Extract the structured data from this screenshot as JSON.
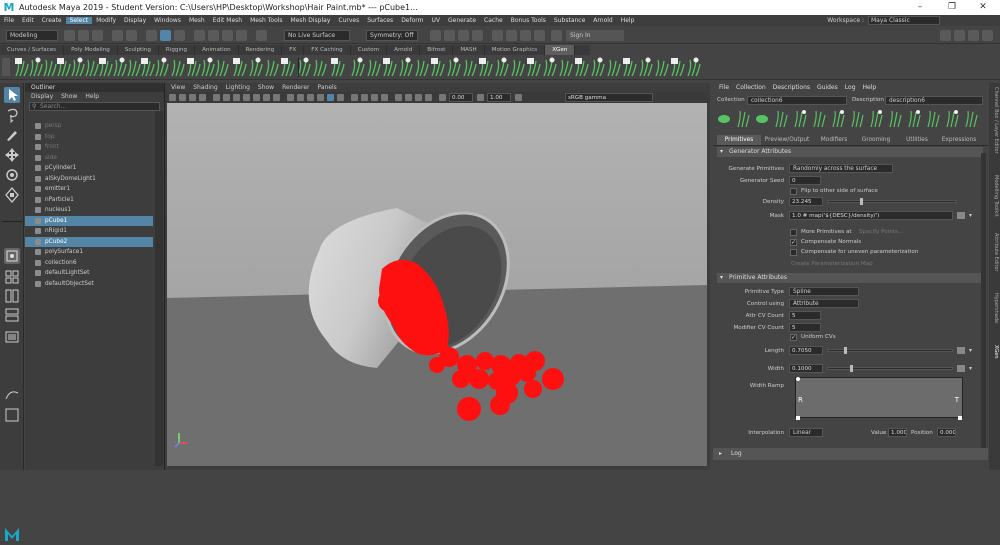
{
  "window": {
    "title": "Autodesk Maya 2019 - Student Version: C:\\Users\\HP\\Desktop\\Workshop\\Hair Paint.mb*  ---  pCube1...",
    "logo": "M",
    "controls": [
      "–",
      "❐",
      "✕"
    ]
  },
  "menubar": {
    "items": [
      "File",
      "Edit",
      "Create",
      "Select",
      "Modify",
      "Display",
      "Windows",
      "Mesh",
      "Edit Mesh",
      "Mesh Tools",
      "Mesh Display",
      "Curves",
      "Surfaces",
      "Deform",
      "UV",
      "Generate",
      "Cache",
      "Bonus Tools",
      "Substance",
      "Arnold",
      "Help"
    ],
    "selected": "Select",
    "workspace_label": "Workspace :",
    "workspace_value": "Maya Classic"
  },
  "statusline": {
    "mode": "Modeling",
    "live_surface": "No Live Surface",
    "symmetry": "Symmetry: Off",
    "sign_in": "Sign In"
  },
  "shelf": {
    "tabs": [
      "Curves / Surfaces",
      "Poly Modeling",
      "Sculpting",
      "Rigging",
      "Animation",
      "Rendering",
      "FX",
      "FX Caching",
      "Custom",
      "Arnold",
      "Bifrost",
      "MASH",
      "Motion Graphics",
      "XGen"
    ],
    "active": "XGen"
  },
  "outliner": {
    "title": "Outliner",
    "menu": [
      "Display",
      "Show",
      "Help"
    ],
    "search_placeholder": "Search...",
    "items": [
      {
        "label": "persp",
        "dim": true,
        "selected": false
      },
      {
        "label": "top",
        "dim": true,
        "selected": false
      },
      {
        "label": "front",
        "dim": true,
        "selected": false
      },
      {
        "label": "side",
        "dim": true,
        "selected": false
      },
      {
        "label": "pCylinder1",
        "dim": false,
        "selected": false
      },
      {
        "label": "aiSkyDomeLight1",
        "dim": false,
        "selected": false
      },
      {
        "label": "emitter1",
        "dim": false,
        "selected": false
      },
      {
        "label": "nParticle1",
        "dim": false,
        "selected": false
      },
      {
        "label": "nucleus1",
        "dim": false,
        "selected": false
      },
      {
        "label": "pCube1",
        "dim": false,
        "selected": true
      },
      {
        "label": "nRigid1",
        "dim": false,
        "selected": false
      },
      {
        "label": "pCube2",
        "dim": false,
        "selected": true
      },
      {
        "label": "polySurface1",
        "dim": false,
        "selected": false
      },
      {
        "label": "collection6",
        "dim": false,
        "selected": false
      },
      {
        "label": "defaultLightSet",
        "dim": false,
        "selected": false
      },
      {
        "label": "defaultObjectSet",
        "dim": false,
        "selected": false
      }
    ]
  },
  "viewport": {
    "menu": [
      "View",
      "Shading",
      "Lighting",
      "Show",
      "Renderer",
      "Panels"
    ],
    "exposure": "0.00",
    "gamma": "1.00",
    "color_space": "sRGB gamma"
  },
  "xgen": {
    "menu": [
      "File",
      "Collection",
      "Descriptions",
      "Guides",
      "Log",
      "Help"
    ],
    "collection_label": "Collection",
    "collection_value": "collection6",
    "description_label": "Description",
    "description_value": "description6",
    "tabs": [
      "Primitives",
      "Preview/Output",
      "Modifiers",
      "Grooming",
      "Utilities",
      "Expressions"
    ],
    "active_tab": "Primitives",
    "generator": {
      "title": "Generator Attributes",
      "generate_primitives_label": "Generate Primitives",
      "generate_primitives_value": "Randomly across the surface",
      "generator_seed_label": "Generator Seed",
      "generator_seed_value": "0",
      "flip_label": "Flip to other side of surface",
      "density_label": "Density",
      "density_value": "23.245",
      "mask_label": "Mask",
      "mask_value": "1.0 # map('${DESC}/density/')",
      "more_primitives_label": "More Primitives at",
      "specify_points": "Specify Points...",
      "compensate_normals": "Compensate Normals",
      "compensate_uneven": "Compensate for uneven parameterization",
      "create_param_map": "Create Parameterization Map"
    },
    "primitive": {
      "title": "Primitive Attributes",
      "primitive_type_label": "Primitive Type",
      "primitive_type_value": "Spline",
      "control_using_label": "Control using",
      "control_using_value": "Attribute",
      "attr_cv_label": "Attr CV Count",
      "attr_cv_value": "5",
      "modifier_cv_label": "Modifier CV Count",
      "modifier_cv_value": "5",
      "uniform_cvs": "Uniform CVs",
      "length_label": "Length",
      "length_value": "0.7050",
      "width_label": "Width",
      "width_value": "0.1000",
      "width_ramp_label": "Width Ramp",
      "ramp_left": "R",
      "ramp_right": "T",
      "interpolation_label": "Interpolation",
      "interpolation_value": "Linear",
      "value_label": "Value",
      "value_value": "1.000",
      "position_label": "Position",
      "position_value": "0.000"
    },
    "log_label": "Log"
  },
  "right_strip": [
    "Channel Box / Layer Editor",
    "Modelling Toolkit",
    "Attribute Editor",
    "Hypershade",
    "XGen"
  ],
  "colors": {
    "accent": "#5285a6",
    "particles": "#ff1010",
    "viewport_bg_top": "#a6a6a6",
    "viewport_floor": "#6d6d6d"
  }
}
